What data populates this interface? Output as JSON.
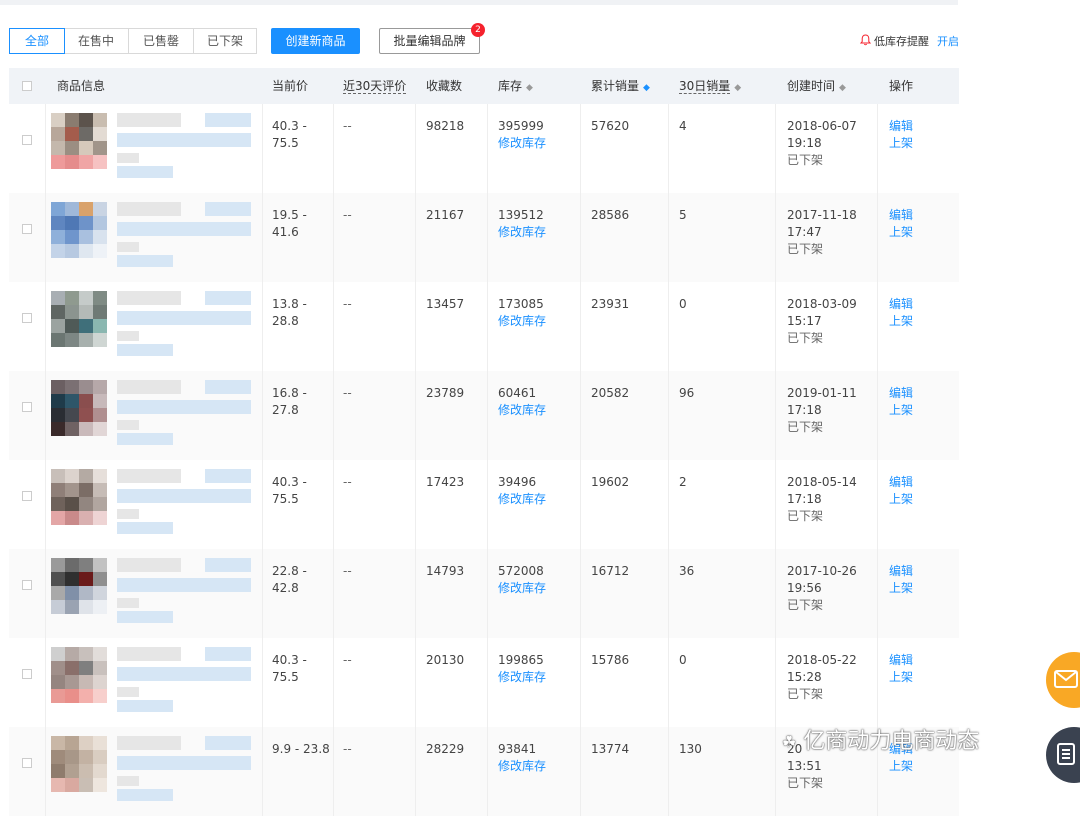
{
  "toolbar": {
    "tabs": [
      {
        "label": "全部",
        "active": true
      },
      {
        "label": "在售中",
        "active": false
      },
      {
        "label": "已售罄",
        "active": false
      },
      {
        "label": "已下架",
        "active": false
      }
    ],
    "create_label": "创建新商品",
    "batch_label": "批量编辑品牌",
    "batch_badge": "2",
    "low_stock_label": "低库存提醒",
    "low_stock_link": "开启"
  },
  "table": {
    "headers": {
      "product": "商品信息",
      "price": "当前价",
      "reviews": "近30天评价",
      "favorites": "收藏数",
      "stock": "库存",
      "total_sales": "累计销量",
      "sales30": "30日销量",
      "created": "创建时间",
      "action": "操作"
    },
    "rows": [
      {
        "price1": "40.3 -",
        "price2": "75.5",
        "reviews": "--",
        "favorites": "98218",
        "stock": "395999",
        "stock_link": "修改库存",
        "total_sales": "57620",
        "sales30": "4",
        "date": "2018-06-07",
        "time": "19:18",
        "status": "已下架",
        "edit": "编辑",
        "shelve": "上架"
      },
      {
        "price1": "19.5 -",
        "price2": "41.6",
        "reviews": "--",
        "favorites": "21167",
        "stock": "139512",
        "stock_link": "修改库存",
        "total_sales": "28586",
        "sales30": "5",
        "date": "2017-11-18",
        "time": "17:47",
        "status": "已下架",
        "edit": "编辑",
        "shelve": "上架"
      },
      {
        "price1": "13.8 -",
        "price2": "28.8",
        "reviews": "--",
        "favorites": "13457",
        "stock": "173085",
        "stock_link": "修改库存",
        "total_sales": "23931",
        "sales30": "0",
        "date": "2018-03-09",
        "time": "15:17",
        "status": "已下架",
        "edit": "编辑",
        "shelve": "上架"
      },
      {
        "price1": "16.8 -",
        "price2": "27.8",
        "reviews": "--",
        "favorites": "23789",
        "stock": "60461",
        "stock_link": "修改库存",
        "total_sales": "20582",
        "sales30": "96",
        "date": "2019-01-11",
        "time": "17:18",
        "status": "已下架",
        "edit": "编辑",
        "shelve": "上架"
      },
      {
        "price1": "40.3 -",
        "price2": "75.5",
        "reviews": "--",
        "favorites": "17423",
        "stock": "39496",
        "stock_link": "修改库存",
        "total_sales": "19602",
        "sales30": "2",
        "date": "2018-05-14",
        "time": "17:18",
        "status": "已下架",
        "edit": "编辑",
        "shelve": "上架"
      },
      {
        "price1": "22.8 -",
        "price2": "42.8",
        "reviews": "--",
        "favorites": "14793",
        "stock": "572008",
        "stock_link": "修改库存",
        "total_sales": "16712",
        "sales30": "36",
        "date": "2017-10-26",
        "time": "19:56",
        "status": "已下架",
        "edit": "编辑",
        "shelve": "上架"
      },
      {
        "price1": "40.3 -",
        "price2": "75.5",
        "reviews": "--",
        "favorites": "20130",
        "stock": "199865",
        "stock_link": "修改库存",
        "total_sales": "15786",
        "sales30": "0",
        "date": "2018-05-22",
        "time": "15:28",
        "status": "已下架",
        "edit": "编辑",
        "shelve": "上架"
      },
      {
        "price1": "9.9 - 23.8",
        "price2": "",
        "reviews": "--",
        "favorites": "28229",
        "stock": "93841",
        "stock_link": "修改库存",
        "total_sales": "13774",
        "sales30": "130",
        "date": "20",
        "time": "13:51",
        "status": "已下架",
        "edit": "编辑",
        "shelve": "上架"
      }
    ]
  },
  "thumb_palettes": [
    [
      "#d9cfc4",
      "#8a7c70",
      "#5c534c",
      "#c9bdb0",
      "#b8a79a",
      "#a45c4c",
      "#6d6a66",
      "#e3dbd3",
      "#c4b8ac",
      "#9b8e82",
      "#d6c9bb",
      "#a1958a",
      "#ee9a9a",
      "#e58c8c",
      "#f0a5a5",
      "#f6c2c2"
    ],
    [
      "#7fa6d6",
      "#9fb8d9",
      "#d9a26b",
      "#c9d4e3",
      "#5f86c0",
      "#4f78b5",
      "#6e93c9",
      "#b3c7e0",
      "#8fb0da",
      "#6f95cc",
      "#a9c0df",
      "#d8e2ee",
      "#c3d3e8",
      "#b7c9e1",
      "#dfe7f0",
      "#eef2f7"
    ],
    [
      "#a8aeb3",
      "#8f9a8f",
      "#c5cbc9",
      "#7f8b84",
      "#5f6663",
      "#8b948f",
      "#b4bab7",
      "#6f7a75",
      "#9ba3a0",
      "#4f5a57",
      "#3f6f7a",
      "#8ab7b0",
      "#6b7672",
      "#7d8784",
      "#a7b0ad",
      "#cfd6d3"
    ],
    [
      "#6b5f62",
      "#7b7073",
      "#9a8d8f",
      "#b6a8a9",
      "#1f3b4a",
      "#2e5669",
      "#8a4e4e",
      "#c7b9ba",
      "#2a2d33",
      "#45484f",
      "#8f5050",
      "#b08f90",
      "#3a2a2a",
      "#6f6263",
      "#c9b9ba",
      "#e1d6d6"
    ],
    [
      "#c8bfb9",
      "#dcd3cd",
      "#b4aaa3",
      "#e6dfda",
      "#8f7f78",
      "#a2948c",
      "#7b6d66",
      "#c6bcb6",
      "#6f625b",
      "#5a5049",
      "#928680",
      "#b1a6a0",
      "#e3a6a6",
      "#c98a8a",
      "#d9b0b0",
      "#eed4d4"
    ],
    [
      "#9a9a9a",
      "#6b6b6b",
      "#7f7f7f",
      "#c2c2c2",
      "#4f4f4f",
      "#2f2f2f",
      "#6a1a1a",
      "#8f8f8f",
      "#a9a9a9",
      "#8090a8",
      "#b0b8c6",
      "#d0d5dd",
      "#c6ccd6",
      "#9aa3b2",
      "#dfe3e9",
      "#edf0f4"
    ],
    [
      "#cfcfcf",
      "#b6aaa6",
      "#c8c0bc",
      "#e2ddda",
      "#a08f8a",
      "#8a6f6a",
      "#7f7f7f",
      "#c9c1bd",
      "#958580",
      "#a89893",
      "#c7b9b4",
      "#ddd4d0",
      "#e99a95",
      "#e98f8a",
      "#f3b0ac",
      "#f7cfcc"
    ],
    [
      "#c9b7a6",
      "#b8a593",
      "#ddd0c4",
      "#e9e0d7",
      "#9f8b7b",
      "#a89788",
      "#c3b2a3",
      "#d9cdc1",
      "#8f7c6d",
      "#b1a091",
      "#cbbdb0",
      "#e3d9cf",
      "#e6b8b0",
      "#d9a9a0",
      "#c9beb4",
      "#eee6de"
    ]
  ],
  "watermark": "亿商动力电商动态"
}
